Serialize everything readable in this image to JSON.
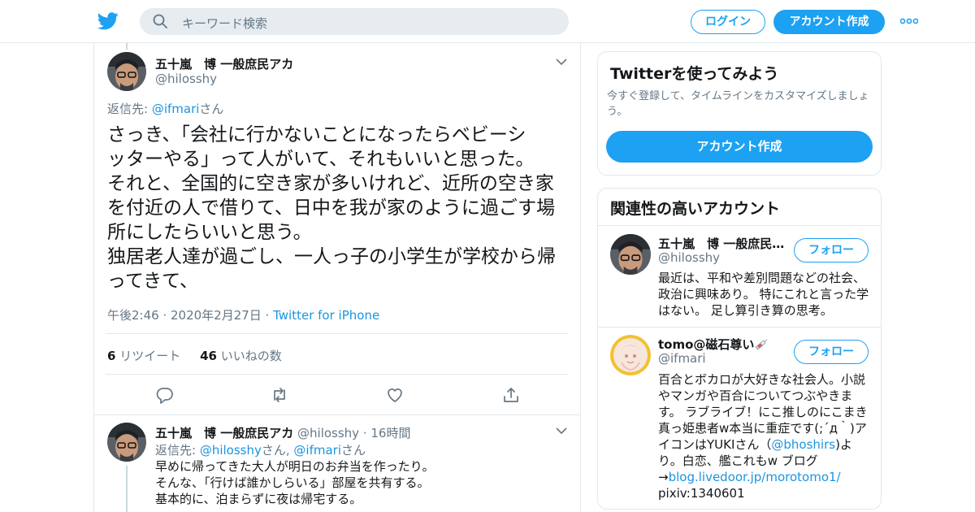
{
  "topbar": {
    "search_placeholder": "キーワード検索",
    "login_label": "ログイン",
    "signup_label": "アカウント作成"
  },
  "main_tweet": {
    "name": "五十嵐　博 一般庶民アカ",
    "handle": "@hilosshy",
    "reply_prefix": "返信先: ",
    "reply_to": "@ifmari",
    "reply_suffix": "さん",
    "text_lines": [
      "さっき、「会社に行かないことになったらベビーシ",
      "ッターやる」って人がいて、それもいいと思った。",
      "それと、全国的に空き家が多いけれど、近所の空き家",
      "を付近の人で借りて、日中を我が家のように過ごす場",
      "所にしたらいいと思う。",
      "独居老人達が過ごし、一人っ子の小学生が学校から帰",
      "ってきて、"
    ],
    "time": "午後2:46 · 2020年2月27日 · ",
    "source": "Twitter for iPhone",
    "retweet_count": "6",
    "retweet_label": " リツイート",
    "like_count": "46",
    "like_label": " いいねの数"
  },
  "reply_tweet": {
    "name": "五十嵐　博 一般庶民アカ",
    "handle": "@hilosshy",
    "dot": " · ",
    "time": "16時間",
    "reply_prefix": "返信先: ",
    "reply_to_1": "@hilosshy",
    "reply_mid": "さん, ",
    "reply_to_2": "@ifmari",
    "reply_suffix": "さん",
    "text_lines": [
      "早めに帰ってきた大人が明日のお弁当を作ったり。",
      "そんな、「行けば誰かしらいる」部屋を共有する。",
      "基本的に、泊まらずに夜は帰宅する。"
    ]
  },
  "signup_card": {
    "title": "Twitterを使ってみよう",
    "subtitle": "今すぐ登録して、タイムラインをカスタマイズしましょう。",
    "button_label": "アカウント作成"
  },
  "related_card": {
    "title": "関連性の高いアカウント",
    "accounts": [
      {
        "name": "五十嵐　博 一般庶民…",
        "handle": "@hilosshy",
        "follow_label": "フォロー",
        "bio_lines": [
          "最近は、平和や差別問題などの社会、",
          "政治に興味あり。 特にこれと言った学",
          "はない。 足し算引き算の思考。"
        ]
      },
      {
        "name": "tomo@磁石尊い",
        "handle": "@ifmari",
        "follow_label": "フォロー",
        "bio_l1": "百合とボカロが大好きな社会人。小説",
        "bio_l2": "やマンガや百合についてつぶやきま",
        "bio_l3": "す。 ラブライブ！にこ推しのにこまき",
        "bio_l4": "真っ姫患者w本当に重症です(;´д｀)ア",
        "bio_l5_pre": "イコンはYUKIさん（",
        "bio_l5_link": "@bhoshirs",
        "bio_l5_post": ")よ",
        "bio_l6": "り。白恋、艦これもw ブログ",
        "bio_l7_arrow": "→",
        "bio_l7_link": "blog.livedoor.jp/morotomo1/",
        "bio_l8": "pixiv:1340601"
      }
    ]
  },
  "colors": {
    "accent": "#1da1f2",
    "link": "#1b95e0",
    "muted": "#657786",
    "text": "#14171a",
    "border": "#e1e8ed"
  }
}
